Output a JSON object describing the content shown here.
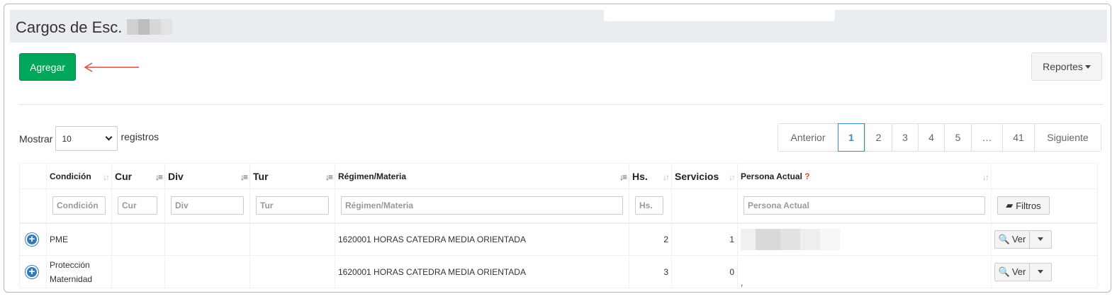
{
  "page": {
    "title": "Cargos de Esc."
  },
  "toolbar": {
    "add_label": "Agregar",
    "reports_label": "Reportes"
  },
  "length": {
    "prefix": "Mostrar",
    "value": "10",
    "suffix": "registros"
  },
  "pagination": {
    "prev": "Anterior",
    "pages": [
      "1",
      "2",
      "3",
      "4",
      "5",
      "…",
      "41"
    ],
    "active": "1",
    "next": "Siguiente"
  },
  "columns": {
    "condicion": "Condición",
    "cur": "Cur",
    "div": "Div",
    "tur": "Tur",
    "regimen": "Régimen/Materia",
    "hs": "Hs.",
    "servicios": "Servicios",
    "persona": "Persona Actual",
    "persona_help": "?"
  },
  "filters": {
    "condicion": "Condición",
    "cur": "Cur",
    "div": "Div",
    "tur": "Tur",
    "regimen": "Régimen/Materia",
    "hs": "Hs.",
    "persona": "Persona Actual",
    "button": "Filtros"
  },
  "rows": [
    {
      "condicion": "PME",
      "regimen": "1620001 HORAS CATEDRA MEDIA ORIENTADA",
      "hs": "2",
      "servicios": "1",
      "persona": "",
      "action": "Ver"
    },
    {
      "condicion": "Protección Maternidad",
      "regimen": "1620001 HORAS CATEDRA MEDIA ORIENTADA",
      "hs": "3",
      "servicios": "0",
      "persona": ",",
      "action": "Ver"
    }
  ],
  "colors": {
    "add_button": "#00a65a",
    "pagination_active": "#3c8dbc",
    "arrow": "#dd4b39"
  },
  "icons": {
    "expand": "plus-circle-icon",
    "search": "magnifier-icon",
    "eraser": "eraser-icon"
  }
}
